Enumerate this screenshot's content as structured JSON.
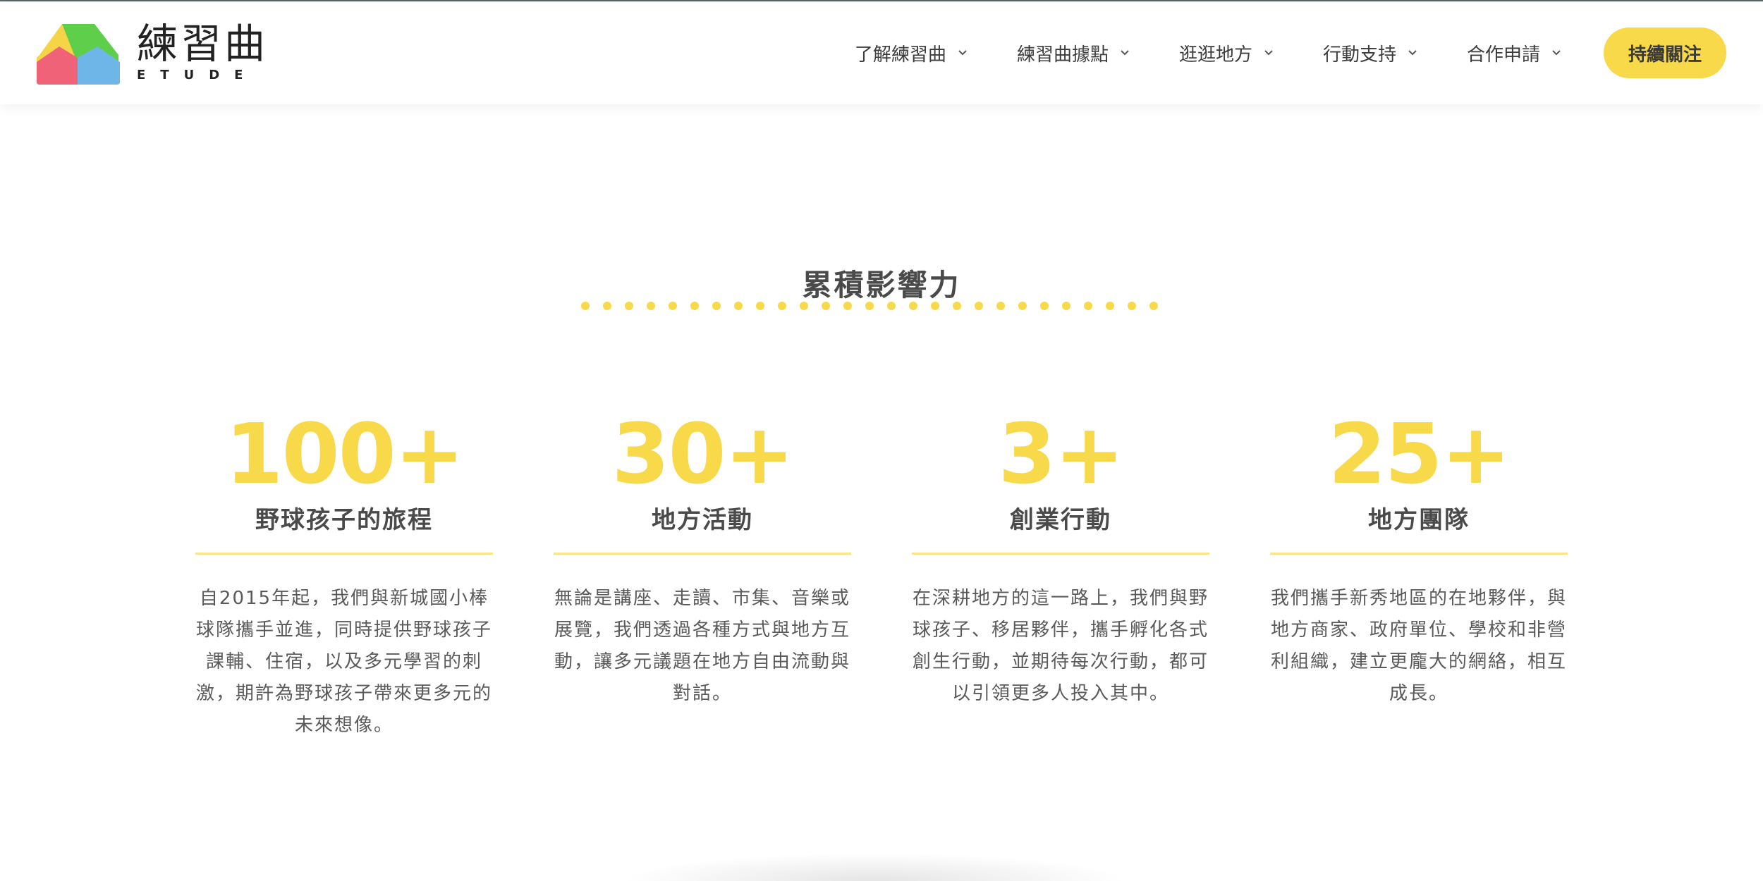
{
  "header": {
    "logo": {
      "title_cn": "練習曲",
      "title_en": "ETUDE",
      "colors": [
        "#f5d547",
        "#5fce4a",
        "#ef6277",
        "#6fb6e8"
      ]
    },
    "nav": [
      {
        "label": "了解練習曲",
        "icon": "chevron-down-icon"
      },
      {
        "label": "練習曲據點",
        "icon": "chevron-down-icon"
      },
      {
        "label": "逛逛地方",
        "icon": "chevron-down-icon"
      },
      {
        "label": "行動支持",
        "icon": "chevron-down-icon"
      },
      {
        "label": "合作申請",
        "icon": "chevron-down-icon"
      }
    ],
    "cta_label": "持續關注"
  },
  "impact": {
    "title": "累積影響力",
    "stats": [
      {
        "number": "100+",
        "label": "野球孩子的旅程",
        "description": "自2015年起，我們與新城國小棒球隊攜手並進，同時提供野球孩子課輔、住宿，以及多元學習的刺激，期許為野球孩子帶來更多元的未來想像。"
      },
      {
        "number": "30+",
        "label": "地方活動",
        "description": "無論是講座、走讀、市集、音樂或展覽，我們透過各種方式與地方互動，讓多元議題在地方自由流動與對話。"
      },
      {
        "number": "3+",
        "label": "創業行動",
        "description": "在深耕地方的這一路上，我們與野球孩子、移居夥伴，攜手孵化各式創生行動，並期待每次行動，都可以引領更多人投入其中。"
      },
      {
        "number": "25+",
        "label": "地方團隊",
        "description": "我們攜手新秀地區的在地夥伴，與地方商家、政府單位、學校和非營利組織，建立更龐大的網絡，相互成長。"
      }
    ]
  },
  "colors": {
    "accent": "#f8d94a",
    "rule": "#f6e58a",
    "heading": "#4a4a4a",
    "body_text": "#5a5a5a"
  }
}
